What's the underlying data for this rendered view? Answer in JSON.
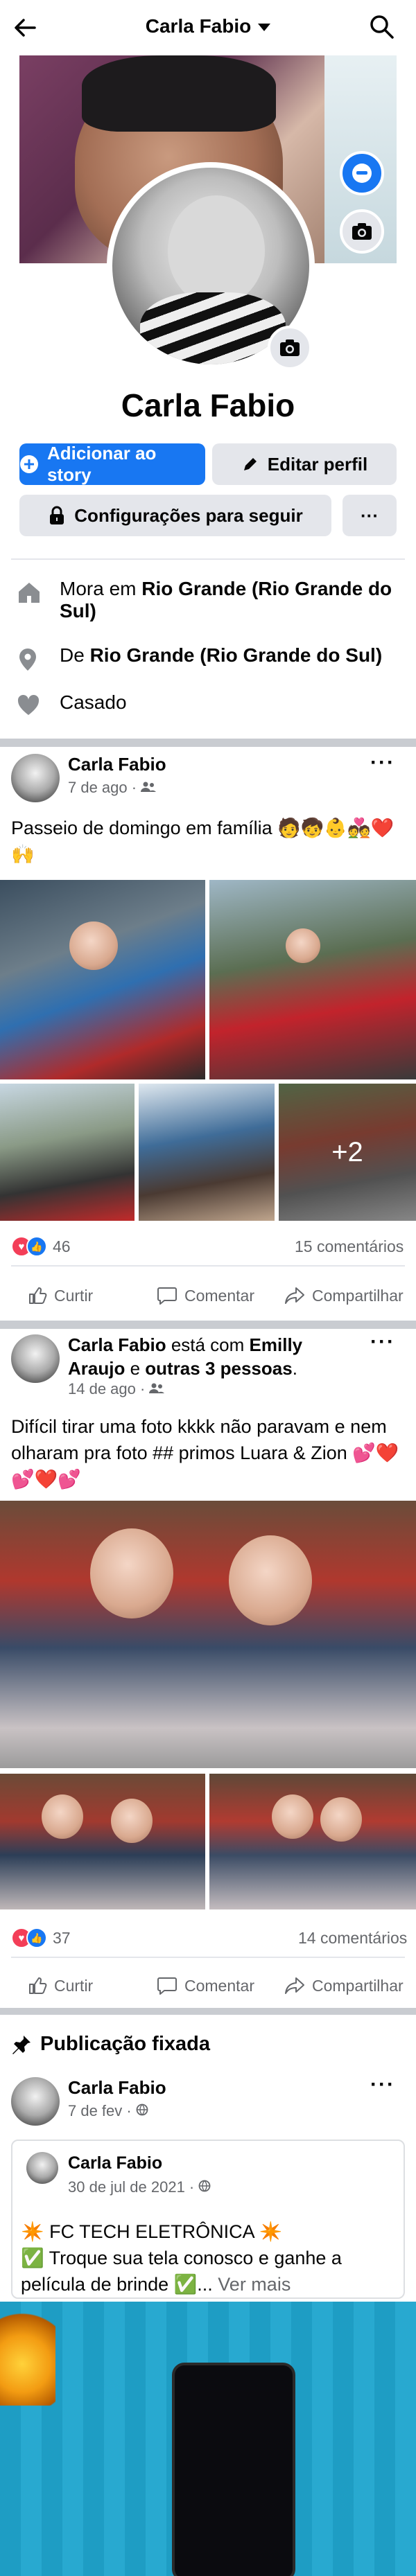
{
  "header": {
    "title": "Carla Fabio"
  },
  "profile": {
    "name": "Carla Fabio",
    "buttons": {
      "add_story": "Adicionar ao story",
      "edit_profile": "Editar perfil",
      "follow_settings": "Configurações para seguir",
      "more": "···"
    },
    "info": {
      "lives_prefix": "Mora em ",
      "lives_place": "Rio Grande (Rio Grande do Sul)",
      "from_prefix": "De ",
      "from_place": "Rio Grande (Rio Grande do Sul)",
      "relationship": "Casado"
    }
  },
  "posts": [
    {
      "author": "Carla Fabio",
      "time": "7 de ago · ",
      "audience_icon": "friends-icon",
      "text": "Passeio de domingo em família 🧑🧒👶💑❤️🙌",
      "extra_photos": "+2",
      "reactions_count": "46",
      "comments": "15 comentários"
    },
    {
      "author": "Carla Fabio",
      "with_text": " está com ",
      "tagged": "Emilly Araujo",
      "and_text": " e ",
      "others": "outras 3 pessoas",
      "period": ".",
      "time": "14 de ago · ",
      "audience_icon": "friends-icon",
      "text": "Difícil tirar uma foto kkkk não paravam e nem olharam pra foto ## primos Luara & Zion 💕❤️💕❤️💕",
      "reactions_count": "37",
      "comments": "14 comentários"
    }
  ],
  "actions": {
    "like": "Curtir",
    "comment": "Comentar",
    "share": "Compartilhar"
  },
  "pinned": {
    "title": "Publicação fixada",
    "author": "Carla Fabio",
    "time": "7 de fev · ",
    "audience_icon": "globe-icon",
    "shared": {
      "author": "Carla Fabio",
      "time": "30 de jul de 2021 · ",
      "audience_icon": "globe-icon",
      "line1": "✴️ FC TECH ELETRÔNICA ✴️",
      "line2": "✅ Troque sua tela conosco e ganhe a película de brinde ✅...",
      "see_more": " Ver mais"
    }
  },
  "colors": {
    "accent": "#1877f2",
    "secondary_button": "#e4e6eb",
    "muted_text": "#65676b",
    "separator": "#c9ccd1"
  }
}
